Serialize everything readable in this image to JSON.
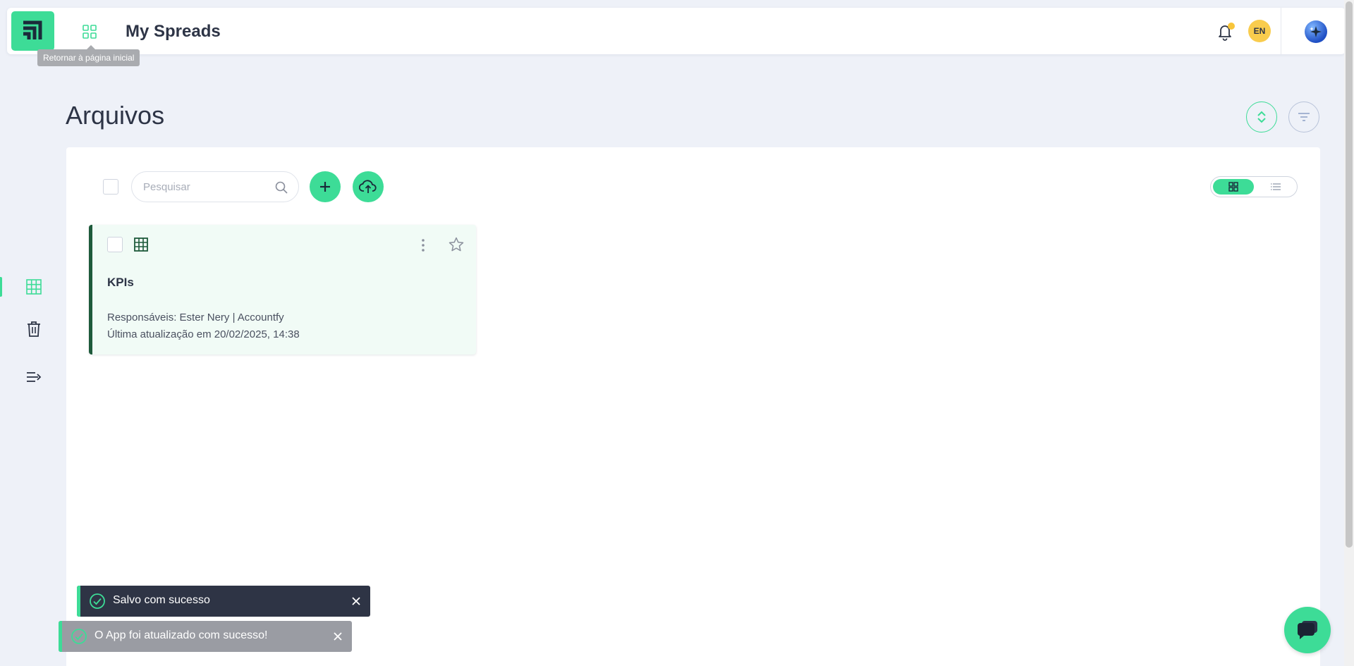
{
  "header": {
    "title": "My Spreads",
    "apps_tooltip": "Retornar à página inicial",
    "language_badge": "EN",
    "logo_icon": "logo-icon",
    "apps_icon": "grid-icon",
    "notification_icon": "bell-icon",
    "ai_icon": "sparkle-icon"
  },
  "sidebar": {
    "items": [
      {
        "name": "spreadsheets",
        "icon": "table-icon",
        "active": true
      },
      {
        "name": "trash",
        "icon": "trash-icon",
        "active": false
      },
      {
        "name": "expand",
        "icon": "expand-menu-icon",
        "active": false
      }
    ]
  },
  "main": {
    "page_title": "Arquivos",
    "sort_icon": "sort-icon",
    "filter_icon": "filter-icon"
  },
  "toolbar": {
    "search_placeholder": "Pesquisar",
    "search_value": "",
    "add_icon": "plus-icon",
    "upload_icon": "cloud-upload-icon",
    "view_mode": "grid"
  },
  "files": [
    {
      "title": "KPIs",
      "owners": "Responsáveis: Ester Nery | Accountfy",
      "updated": "Última atualização em 20/02/2025, 14:38",
      "type_icon": "spreadsheet-icon",
      "starred": false
    }
  ],
  "toasts": [
    {
      "message": "Salvo com sucesso",
      "background": "#2e3445"
    },
    {
      "message": "O App foi atualizado com sucesso!",
      "background": "#9a9ca3"
    }
  ],
  "colors": {
    "accent": "#3ddc97",
    "card_border": "#1e5a3b",
    "background": "#eef1f8"
  },
  "chat_icon": "chat-icon"
}
